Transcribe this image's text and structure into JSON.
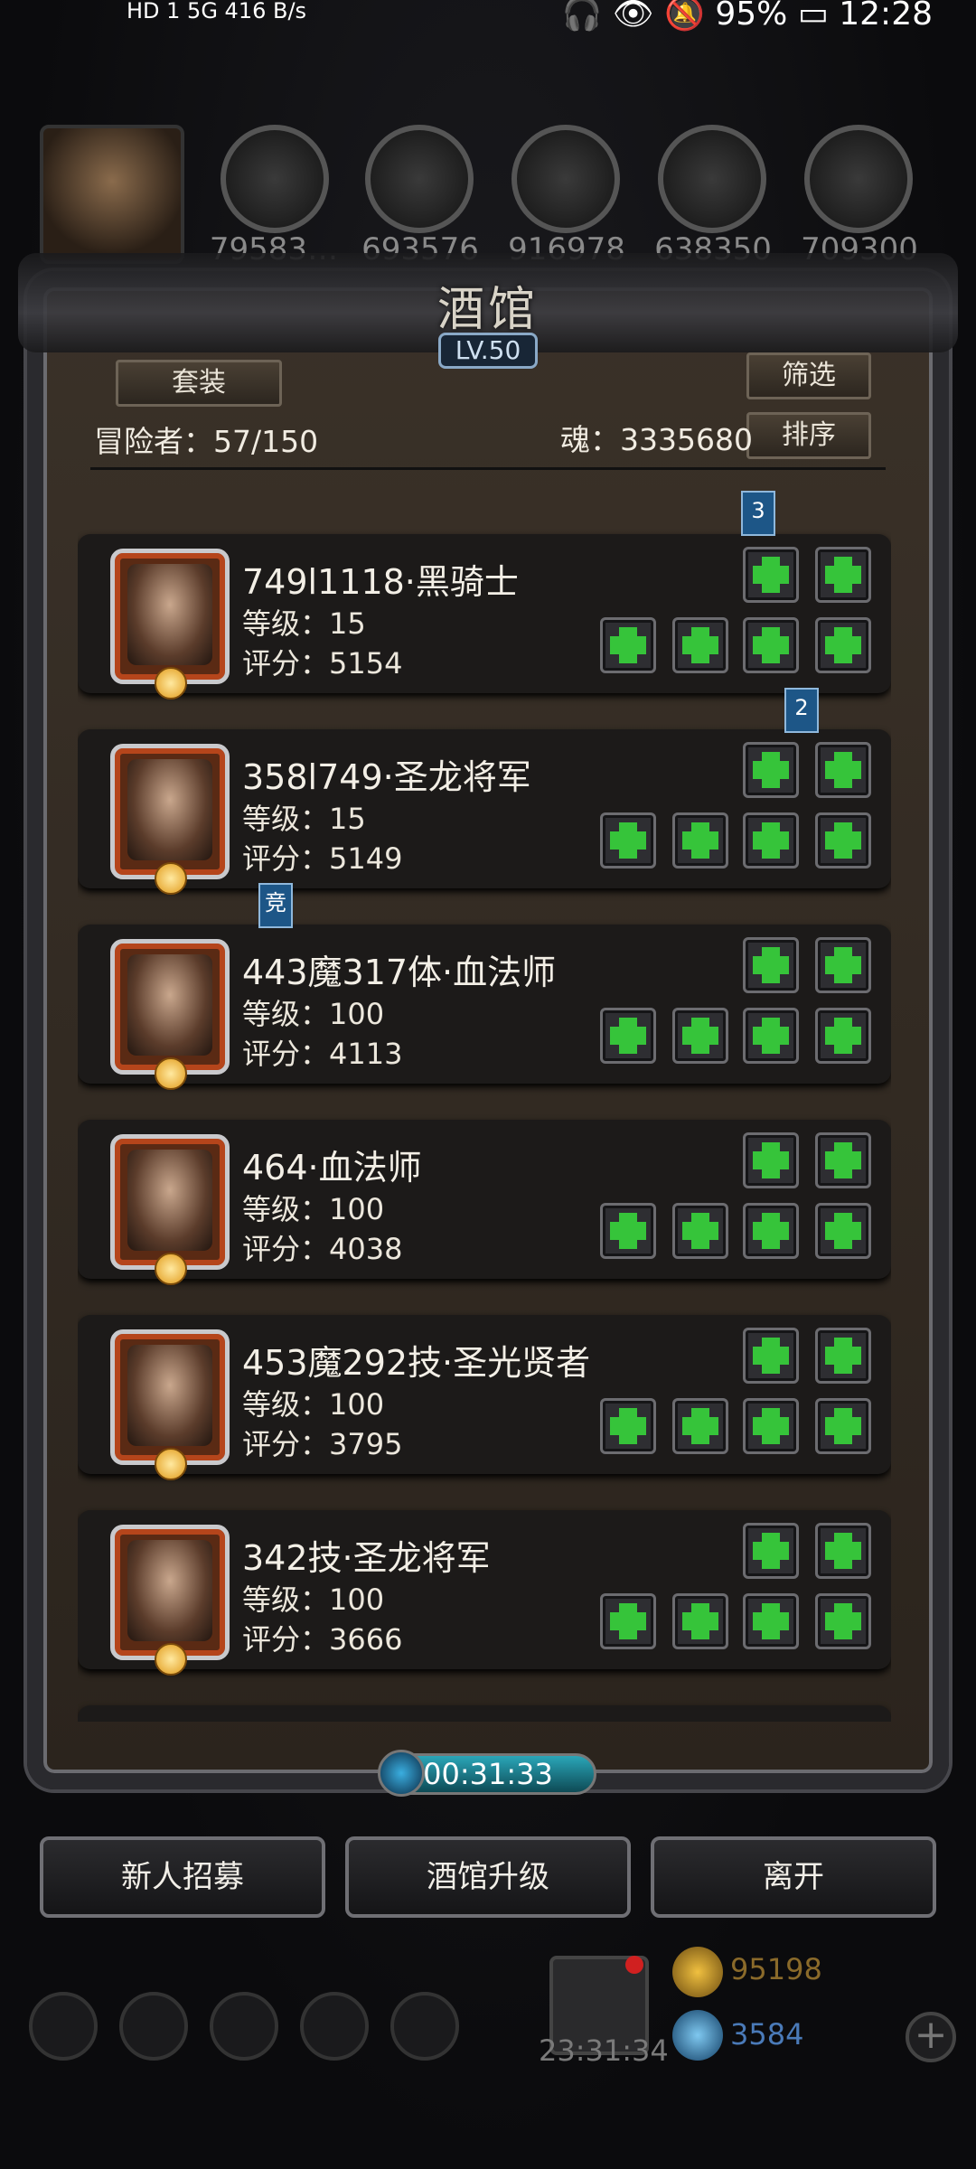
{
  "status_bar": {
    "left": "HD 1 5G 416 B/s",
    "battery": "95%",
    "time": "12:28"
  },
  "resources": {
    "values": [
      "79583…",
      "693576",
      "916978",
      "638350",
      "709300"
    ]
  },
  "tavern": {
    "title": "酒馆",
    "level": "LV.50",
    "suit_btn": "套装",
    "filter_btn": "筛选",
    "sort_btn": "排序",
    "adventurers": "冒险者：57/150",
    "soul": "魂：3335680"
  },
  "heroes": [
    {
      "name": "749l1118·黑骑士",
      "level": "等级：15",
      "score": "评分：5154",
      "tag": "3"
    },
    {
      "name": "358l749·圣龙将军",
      "level": "等级：15",
      "score": "评分：5149",
      "tag": "2"
    },
    {
      "name": "443魔317体·血法师",
      "level": "等级：100",
      "score": "评分：4113",
      "tag": "竞"
    },
    {
      "name": "464·血法师",
      "level": "等级：100",
      "score": "评分：4038",
      "tag": ""
    },
    {
      "name": "453魔292技·圣光贤者",
      "level": "等级：100",
      "score": "评分：3795",
      "tag": ""
    },
    {
      "name": "342技·圣龙将军",
      "level": "等级：100",
      "score": "评分：3666",
      "tag": ""
    }
  ],
  "timer": "00:31:33",
  "actions": {
    "recruit": "新人招募",
    "upgrade": "酒馆升级",
    "leave": "离开"
  },
  "bottom": {
    "gift_timer": "23:31:34",
    "gold": "95198",
    "gem": "3584"
  }
}
